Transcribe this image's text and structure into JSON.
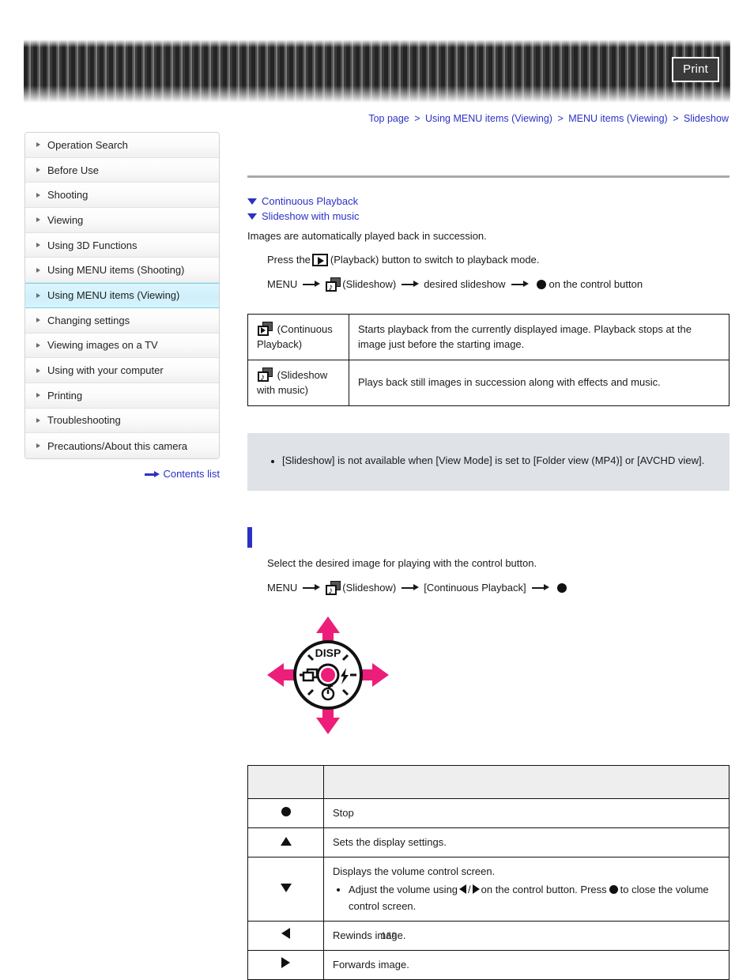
{
  "header": {
    "print_label": "Print",
    "print_icon": "printer-icon"
  },
  "breadcrumb": {
    "items": [
      "Top page",
      "Using MENU items (Viewing)",
      "MENU items (Viewing)",
      "Slideshow"
    ],
    "separator": ">"
  },
  "sidebar": {
    "items": [
      {
        "label": "Operation Search",
        "active": false
      },
      {
        "label": "Before Use",
        "active": false
      },
      {
        "label": "Shooting",
        "active": false
      },
      {
        "label": "Viewing",
        "active": false
      },
      {
        "label": "Using 3D Functions",
        "active": false
      },
      {
        "label": "Using MENU items (Shooting)",
        "active": false
      },
      {
        "label": "Using MENU items (Viewing)",
        "active": true
      },
      {
        "label": "Changing settings",
        "active": false
      },
      {
        "label": "Viewing images on a TV",
        "active": false
      },
      {
        "label": "Using with your computer",
        "active": false
      },
      {
        "label": "Printing",
        "active": false
      },
      {
        "label": "Troubleshooting",
        "active": false
      },
      {
        "label": "Precautions/About this camera",
        "active": false
      }
    ],
    "contents_link": "Contents list",
    "contents_icon": "arrow-right-icon",
    "highlight_color": "#cfeffb",
    "link_color": "#2b31c4"
  },
  "main": {
    "page_title": "",
    "anchors": [
      {
        "label": "Continuous Playback",
        "icon": "triangle-down-icon"
      },
      {
        "label": "Slideshow with music",
        "icon": "triangle-down-icon"
      }
    ],
    "intro": "Images are automatically played back in succession.",
    "step1": {
      "before": "Press the",
      "icon": "playback-icon",
      "after": "(Playback) button to switch to playback mode."
    },
    "step2": {
      "menu": "MENU",
      "icon": "slideshow-icon",
      "slideshow_label": "(Slideshow)",
      "desired": "desired slideshow",
      "tail": "on the control button"
    },
    "mode_table": {
      "rows": [
        {
          "icon": "continuous-playback-icon",
          "mode": "(Continuous Playback)",
          "description": "Starts playback from the currently displayed image. Playback stops at the image just before the starting image."
        },
        {
          "icon": "slideshow-music-icon",
          "mode": "(Slideshow with music)",
          "description": "Plays back still images in succession along with effects and music."
        }
      ]
    },
    "note_box": {
      "background": "#dfe3e8",
      "items": [
        "[Slideshow] is not available when [View Mode] is set to [Folder view (MP4)] or [AVCHD view]."
      ]
    },
    "section": {
      "marker_color": "#2b31c4",
      "title": "",
      "lead": "Select the desired image for playing with the control button.",
      "path": {
        "menu": "MENU",
        "icon": "slideshow-icon",
        "slideshow_label": "(Slideshow)",
        "option": "[Continuous Playback]"
      }
    },
    "dial": {
      "disp_label": "DISP",
      "center_icon": "center-button-icon",
      "left_icon": "burst-mode-icon",
      "right_icon": "flash-icon",
      "bottom_icon": "self-timer-icon",
      "accent_color": "#ec1e79"
    },
    "ops_table": {
      "header": [
        "",
        ""
      ],
      "rows": [
        {
          "key_icon": "center-dot-icon",
          "text": "Stop",
          "bullets": []
        },
        {
          "key_icon": "triangle-up-icon",
          "text": "Sets the display settings.",
          "bullets": []
        },
        {
          "key_icon": "triangle-down-icon",
          "text": "Displays the volume control screen.",
          "bullets": [
            {
              "a": "Adjust the volume using",
              "b": "/",
              "c": "on the control button. Press",
              "d": "to close the volume control screen."
            }
          ]
        },
        {
          "key_icon": "triangle-left-icon",
          "text": "Rewinds image.",
          "bullets": []
        },
        {
          "key_icon": "triangle-right-icon",
          "text": "Forwards image.",
          "bullets": []
        }
      ]
    }
  },
  "footer": {
    "page_number": "169"
  }
}
